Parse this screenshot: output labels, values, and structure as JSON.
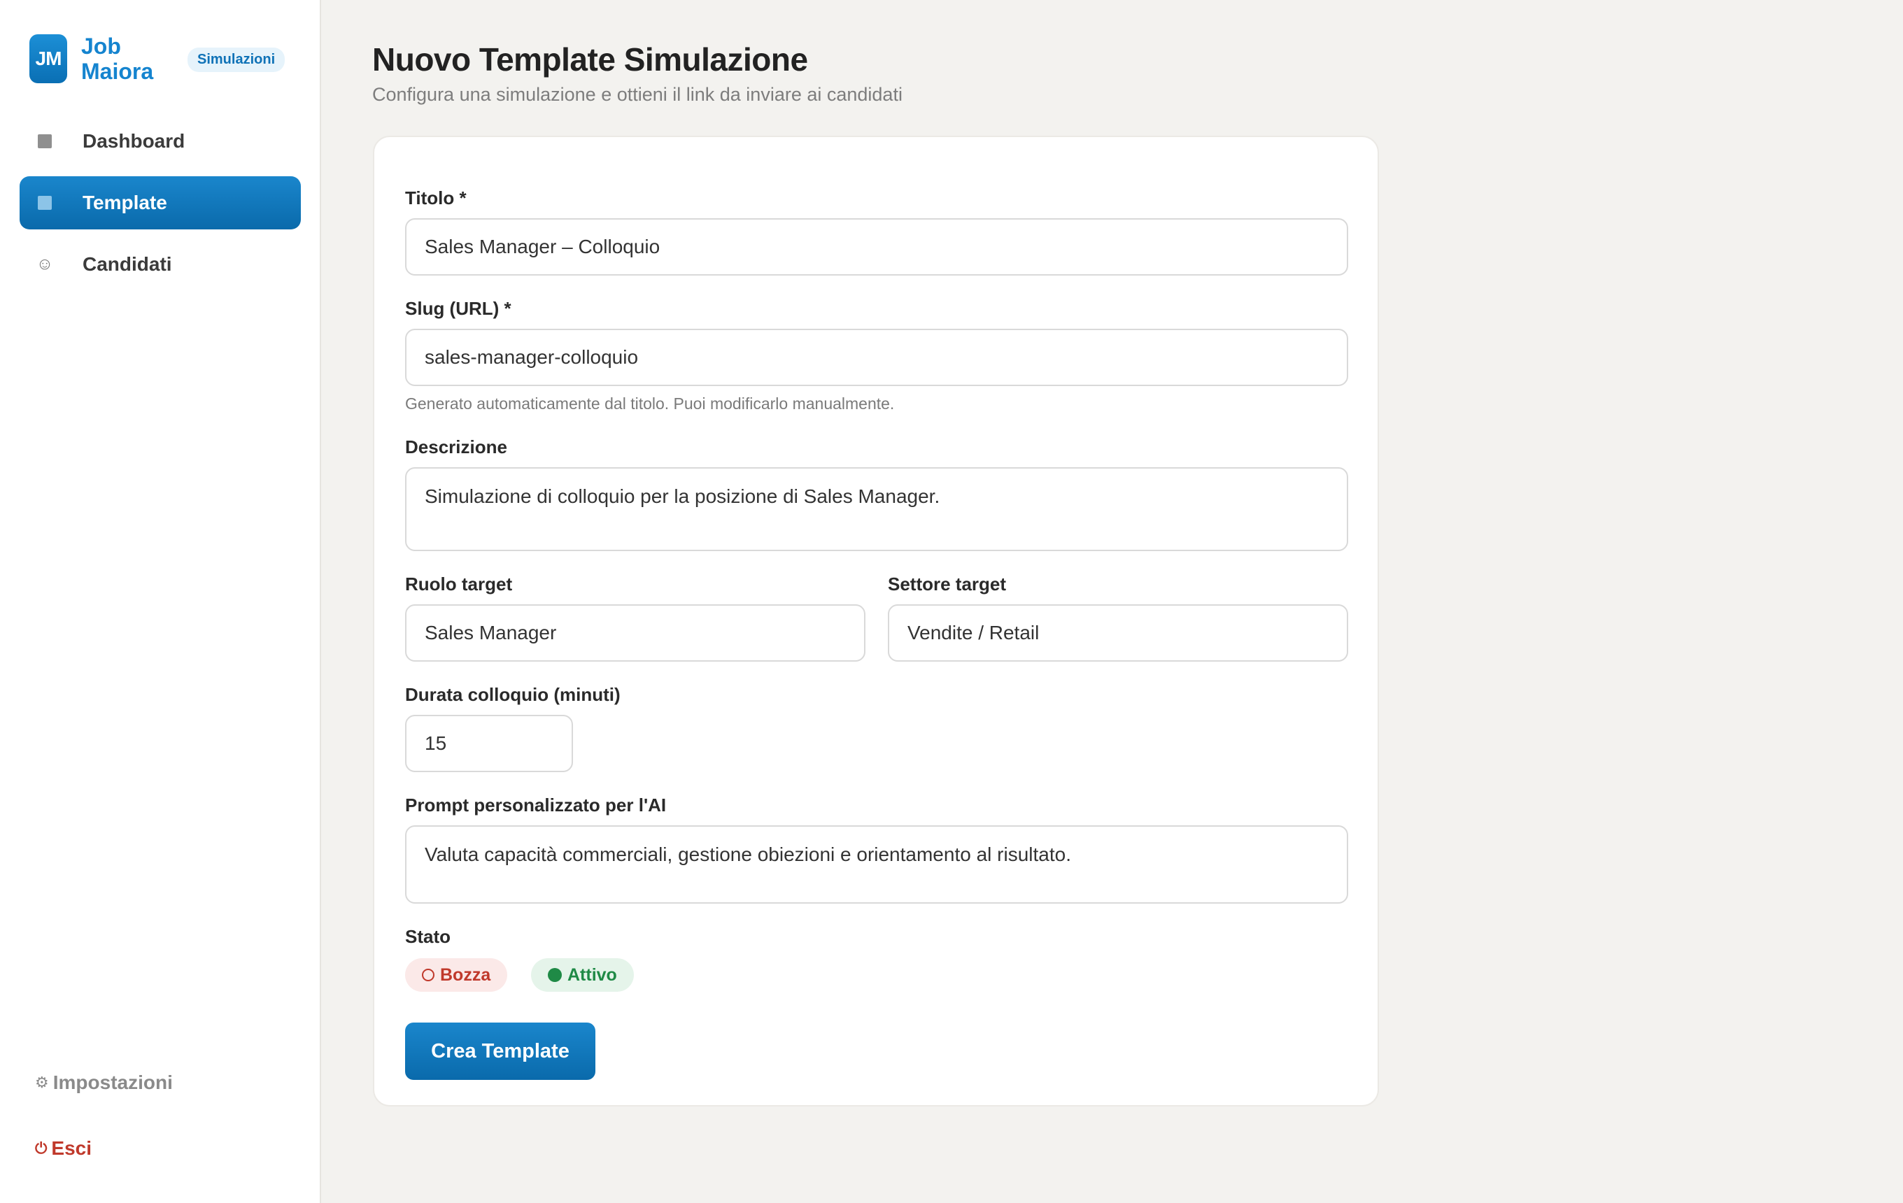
{
  "brand": {
    "logo": "JM",
    "name": "Job Maiora",
    "badge": "Simulazioni",
    "accent_color": "#1584cf"
  },
  "sidebar": {
    "items": [
      {
        "label": "Dashboard",
        "icon": "square-icon",
        "active": false
      },
      {
        "label": "Template",
        "icon": "square-icon",
        "active": true
      },
      {
        "label": "Candidati",
        "icon": "smiley-icon",
        "active": false
      }
    ],
    "settings": {
      "label": "Impostazioni",
      "icon": "⚙"
    },
    "logout": {
      "label": "Esci",
      "icon": "⏻"
    }
  },
  "header": {
    "title": "Nuovo Template Simulazione",
    "subtitle": "Configura una simulazione e ottieni il link da inviare ai candidati"
  },
  "form": {
    "title": {
      "label": "Titolo *",
      "value": "Sales Manager – Colloquio"
    },
    "slug": {
      "label": "Slug (URL) *",
      "value": "sales-manager-colloquio",
      "hint": "Generato automaticamente dal titolo. Puoi modificarlo manualmente."
    },
    "description": {
      "label": "Descrizione",
      "value": "Simulazione di colloquio per la posizione di Sales Manager."
    },
    "role": {
      "label": "Ruolo target",
      "value": "Sales Manager"
    },
    "sector": {
      "label": "Settore target",
      "value": "Vendite / Retail"
    },
    "duration": {
      "label": "Durata colloquio (minuti)",
      "value": "15"
    },
    "prompt": {
      "label": "Prompt personalizzato per l'AI",
      "value": "Valuta capacità commerciali, gestione obiezioni e orientamento al risultato."
    },
    "status": {
      "label": "Stato",
      "options": [
        {
          "label": "Bozza",
          "color": "#c0392b",
          "selected": false
        },
        {
          "label": "Attivo",
          "color": "#1f8a46",
          "selected": true
        }
      ]
    },
    "submit_label": "Crea Template"
  }
}
